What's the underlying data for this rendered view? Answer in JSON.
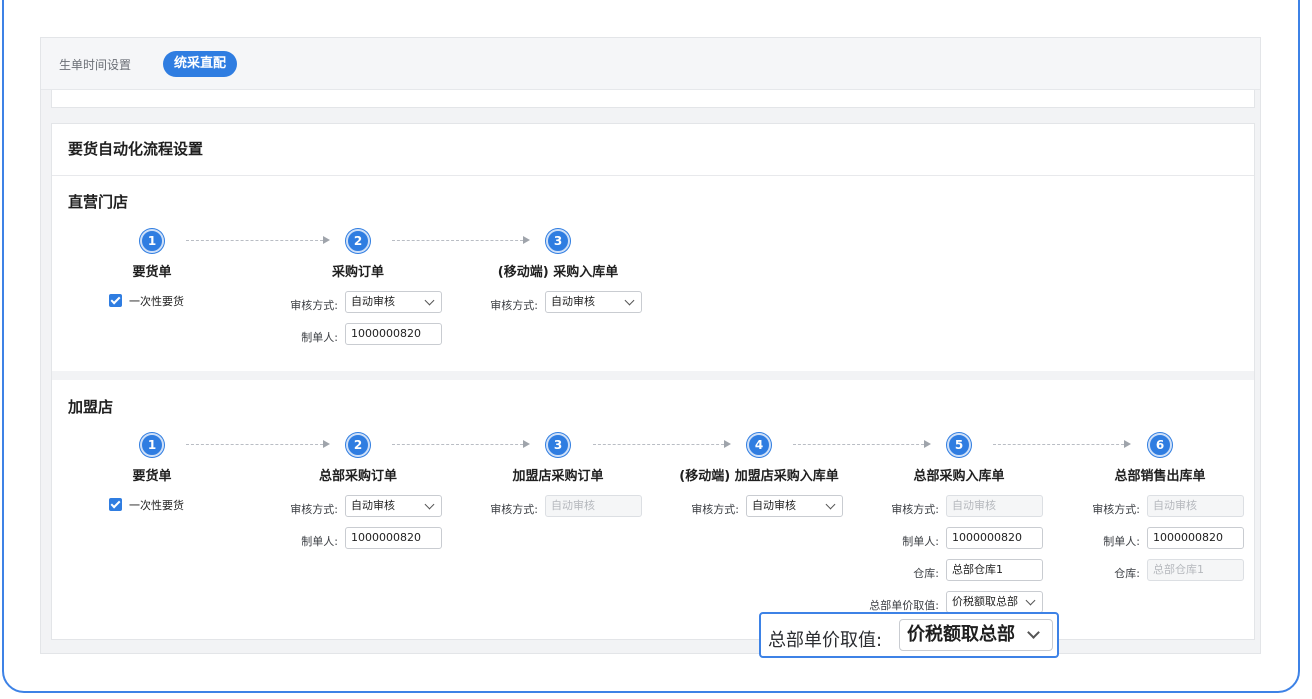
{
  "tabs": {
    "inactive": "生单时间设置",
    "active": "统采直配"
  },
  "card_title": "要货自动化流程设置",
  "direct": {
    "title": "直营门店",
    "steps": [
      {
        "num": "1",
        "label": "要货单"
      },
      {
        "num": "2",
        "label": "采购订单"
      },
      {
        "num": "3",
        "label": "(移动端) 采购入库单"
      }
    ],
    "checkbox_label": "一次性要货",
    "review_label": "审核方式:",
    "maker_label": "制单人:",
    "step2_review": "自动审核",
    "step2_maker": "1000000820",
    "step3_review": "自动审核"
  },
  "franchise": {
    "title": "加盟店",
    "steps": [
      {
        "num": "1",
        "label": "要货单"
      },
      {
        "num": "2",
        "label": "总部采购订单"
      },
      {
        "num": "3",
        "label": "加盟店采购订单"
      },
      {
        "num": "4",
        "label": "(移动端) 加盟店采购入库单"
      },
      {
        "num": "5",
        "label": "总部采购入库单"
      },
      {
        "num": "6",
        "label": "总部销售出库单"
      }
    ],
    "checkbox_label": "一次性要货",
    "review_label": "审核方式:",
    "maker_label": "制单人:",
    "warehouse_label": "仓库:",
    "price_label": "总部单价取值:",
    "step2_review": "自动审核",
    "step2_maker": "1000000820",
    "step3_review": "自动审核",
    "step4_review": "自动审核",
    "step5_review": "自动审核",
    "step5_maker": "1000000820",
    "step5_warehouse": "总部仓库1",
    "step5_price": "价税额取总部",
    "step6_review": "自动审核",
    "step6_maker": "1000000820",
    "step6_warehouse": "总部仓库1"
  },
  "zoom": {
    "label": "总部单价取值:",
    "value": "价税额取总部"
  },
  "colors": {
    "accent": "#2f7de1",
    "frame": "#3d82e6"
  }
}
